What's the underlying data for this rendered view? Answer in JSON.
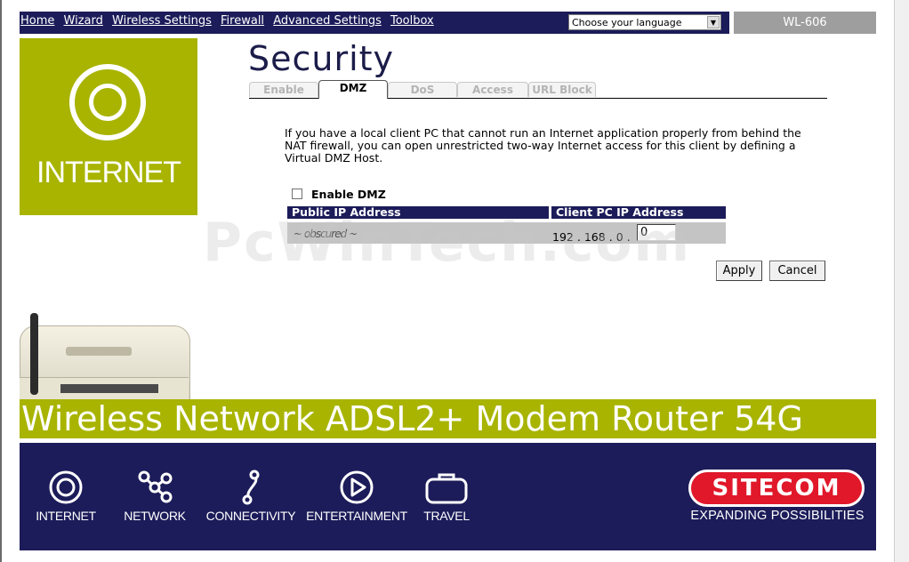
{
  "nav": {
    "links": [
      "Home",
      "Wizard",
      "Wireless Settings",
      "Firewall",
      "Advanced Settings",
      "Toolbox"
    ],
    "language_select": "Choose your language",
    "model": "WL-606"
  },
  "left_panel": {
    "label": "INTERNET"
  },
  "page": {
    "title": "Security",
    "tabs": [
      {
        "label": "Enable",
        "active": false
      },
      {
        "label": "DMZ",
        "active": true
      },
      {
        "label": "DoS",
        "active": false
      },
      {
        "label": "Access",
        "active": false
      },
      {
        "label": "URL Block",
        "active": false
      }
    ],
    "description": "If you have a local client PC that cannot run an Internet application properly from behind the NAT firewall, you can open unrestricted two-way Internet access for this client by defining a Virtual DMZ Host.",
    "enable_dmz_label": "Enable DMZ",
    "enable_dmz_checked": false,
    "table": {
      "col_public": "Public IP Address",
      "col_client": "Client PC IP Address",
      "public_ip_value": "~ obscured ~",
      "client_ip_prefix": [
        "192",
        "168",
        "0"
      ],
      "client_ip_last": "0"
    },
    "apply_label": "Apply",
    "cancel_label": "Cancel"
  },
  "watermark": "PcWinTech.com",
  "product_bar": {
    "text": "Wireless Network ADSL2+ Modem Router 54G"
  },
  "footer": {
    "items": [
      "INTERNET",
      "NETWORK",
      "CONNECTIVITY",
      "ENTERTAINMENT",
      "TRAVEL"
    ],
    "brand": "SITECOM",
    "tagline": "EXPANDING POSSIBILITIES"
  },
  "colors": {
    "navy": "#1c1c5a",
    "olive": "#a8b400",
    "brand_red": "#e0182a"
  }
}
